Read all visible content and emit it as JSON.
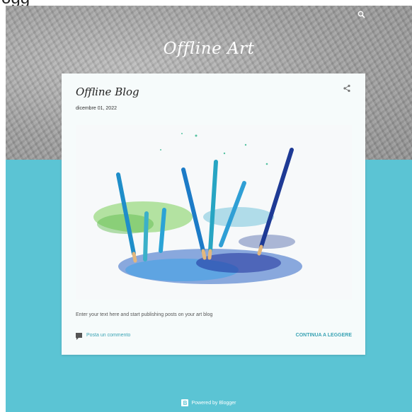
{
  "top_strip_text": "ogg",
  "header": {
    "blog_title": "Offline Art"
  },
  "post": {
    "title": "Offline Blog",
    "date": "dicembre 01, 2022",
    "snippet": "Enter your text here and start publishing posts on your art blog",
    "comment_label": "Posta un commento",
    "read_more_label": "CONTINUA A LEGGERE"
  },
  "footer": {
    "powered_label": "Powered by Blogger"
  },
  "icons": {
    "search": "search-icon",
    "share": "share-icon",
    "comment": "comment-icon",
    "blogger": "blogger-icon"
  },
  "colors": {
    "page_background": "#5bc4d4",
    "card_background": "#f6fbfb",
    "link_accent": "#3aa3b4",
    "header_texture": "#9c9c9c"
  }
}
